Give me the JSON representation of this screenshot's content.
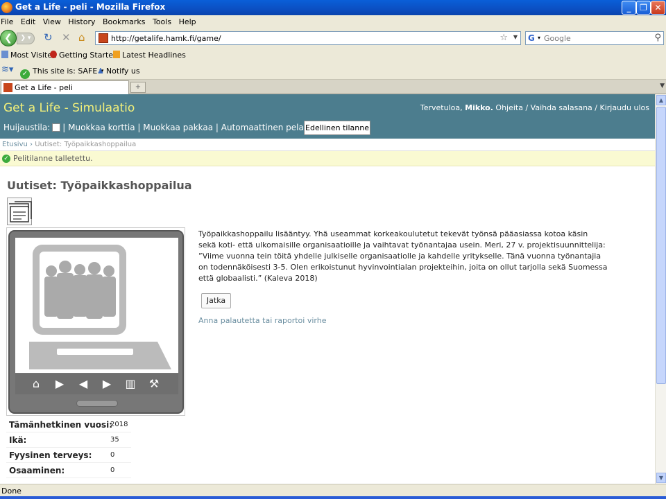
{
  "window": {
    "title": "Get a Life - peli - Mozilla Firefox"
  },
  "menu": [
    "File",
    "Edit",
    "View",
    "History",
    "Bookmarks",
    "Tools",
    "Help"
  ],
  "nav": {
    "url": "http://getalife.hamk.fi/game/",
    "search_placeholder": "Google"
  },
  "bookmarks": [
    "Most Visited",
    "Getting Started",
    "Latest Headlines"
  ],
  "addons": {
    "site_status": "This site is: SAFE",
    "notify": "Notify us"
  },
  "tab": {
    "label": "Get a Life - peli"
  },
  "header": {
    "brand": "Get a Life - Simulaatio",
    "greeting": "Tervetuloa,",
    "user": "Mikko.",
    "links": "Ohjeita / Vaihda salasana / Kirjaudu ulos",
    "cheat_label": "Huijaustila:",
    "tools": "| Muokkaa korttia | Muokkaa pakkaa | Automaattinen pelaaja",
    "prev_state": "Edellinen tilanne"
  },
  "breadcrumb": {
    "home": "Etusivu",
    "sep": "›",
    "current": "Uutiset: Työpaikkashoppailua"
  },
  "notice": "Pelitilanne talletettu.",
  "heading": "Uutiset: Työpaikkashoppailua",
  "article": "Työpaikkashoppailu lisääntyy. Yhä useammat korkeakoulutetut tekevät työnsä pääasiassa kotoa käsin sekä koti- että ulkomaisille organisaatioille ja vaihtavat työnantajaa usein. Meri, 27 v. projektisuunnittelija: ”Viime vuonna tein töitä yhdelle julkiselle organisaatiolle ja kahdelle yritykselle. Tänä vuonna työnantajia on todennäköisesti 3-5. Olen erikoistunut hyvinvointialan projekteihin, joita on ollut tarjolla sekä Suomessa että globaalisti.” (Kaleva 2018)",
  "continue": "Jatka",
  "feedback": "Anna palautetta tai raportoi virhe",
  "stats": [
    {
      "label": "Tämänhetkinen vuosi:",
      "value": "2018"
    },
    {
      "label": "Ikä:",
      "value": "35"
    },
    {
      "label": "Fyysinen terveys:",
      "value": "0"
    },
    {
      "label": "Osaaminen:",
      "value": "0"
    }
  ],
  "status": "Done"
}
